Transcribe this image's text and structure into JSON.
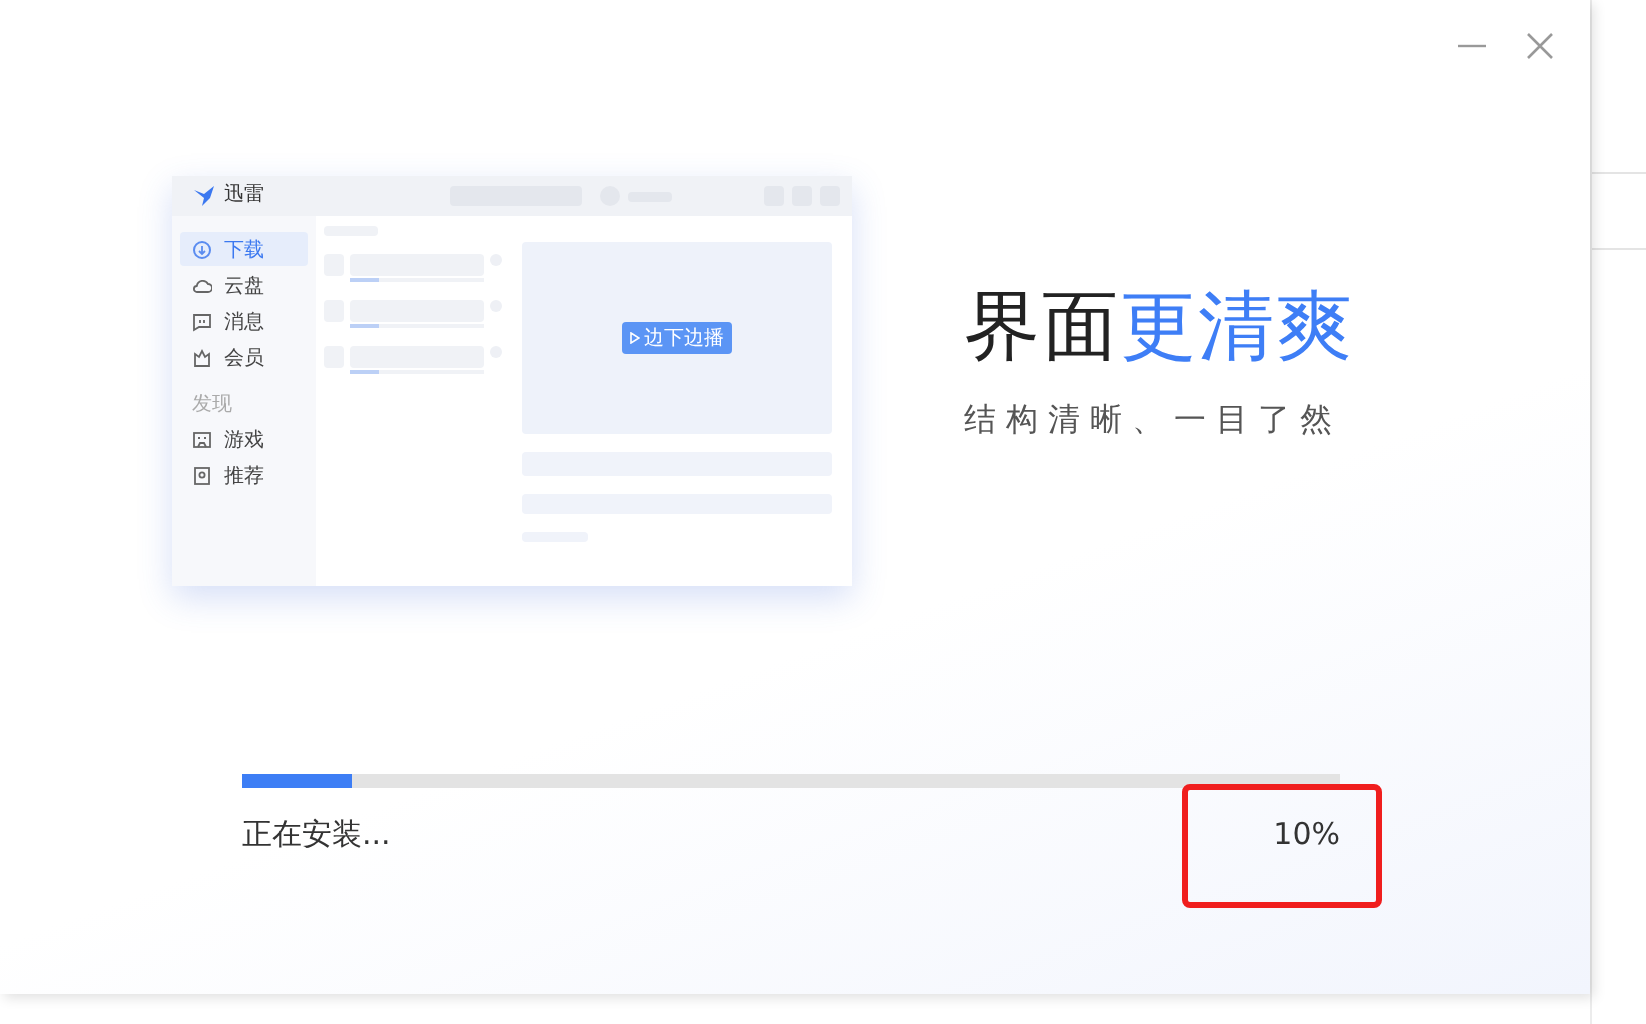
{
  "headline": {
    "plain": "界面",
    "accent": "更清爽"
  },
  "subtitle": "结构清晰、一目了然",
  "preview": {
    "app_name": "迅雷",
    "nav": [
      {
        "label": "下载",
        "kind": "download",
        "selected": true
      },
      {
        "label": "云盘",
        "kind": "cloud",
        "selected": false
      },
      {
        "label": "消息",
        "kind": "message",
        "selected": false
      },
      {
        "label": "会员",
        "kind": "member",
        "selected": false
      }
    ],
    "section": "发现",
    "discover": [
      {
        "label": "游戏",
        "kind": "game",
        "selected": false
      },
      {
        "label": "推荐",
        "kind": "recommend",
        "selected": false
      }
    ],
    "play_button": "边下边播"
  },
  "progress": {
    "level": 0.1,
    "status": "正在安装...",
    "percent": "10%",
    "highlighted": true
  }
}
